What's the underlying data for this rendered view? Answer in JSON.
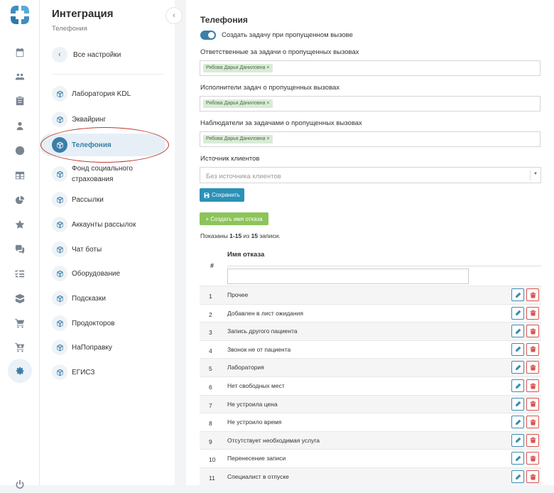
{
  "rail": {
    "icons": [
      "calendar-icon",
      "users-icon",
      "clipboard-icon",
      "user-icon",
      "clock-icon",
      "table-icon",
      "pie-chart-icon",
      "star-icon",
      "chat-icon",
      "list-check-icon",
      "box-icon",
      "cart-icon",
      "cart-plus-icon",
      "gear-icon"
    ],
    "power_icon": "power-icon"
  },
  "panel": {
    "title": "Интеграция",
    "subtitle": "Телефония",
    "collapse": "‹",
    "back": {
      "chevron": "‹",
      "label": "Все настройки"
    },
    "items": [
      {
        "label": "Лаборатория KDL"
      },
      {
        "label": "Эквайринг"
      },
      {
        "label": "Телефония",
        "active": true
      },
      {
        "label": "Фонд социального страхования"
      },
      {
        "label": "Рассылки"
      },
      {
        "label": "Аккаунты рассылок"
      },
      {
        "label": "Чат боты"
      },
      {
        "label": "Оборудование"
      },
      {
        "label": "Подсказки"
      },
      {
        "label": "Продокторов"
      },
      {
        "label": "НаПоправку"
      },
      {
        "label": "ЕГИСЗ"
      }
    ]
  },
  "main": {
    "title": "Телефония",
    "toggle_label": "Создать задачу при пропущенном вызове",
    "toggle_on": true,
    "responsible_label": "Ответственные за задачи о пропущенных вызовах",
    "responsible_tag": "Рябова Дарья Даниловна ×",
    "executors_label": "Исполнители задач о пропущенных вызовах",
    "executors_tag": "Рябова Дарья Даниловна ×",
    "observers_label": "Наблюдатели за задачами о пропущенных вызовах",
    "observers_tag": "Рябова Дарья Даниловна ×",
    "source_label": "Источник клиентов",
    "source_value": "Без источника клиентов",
    "save_button": "Сохранить",
    "add_button": "+ Создать имя отказа",
    "summary": {
      "prefix": "Показаны ",
      "range": "1-15",
      "of": " из ",
      "total": "15",
      "suffix": " записи."
    },
    "table": {
      "col_num": "#",
      "col_name": "Имя отказа",
      "rows": [
        {
          "n": "1",
          "name": "Прочее"
        },
        {
          "n": "2",
          "name": "Добавлен в лист ожидания"
        },
        {
          "n": "3",
          "name": "Запись другого пациента"
        },
        {
          "n": "4",
          "name": "Звонок не от пациента"
        },
        {
          "n": "5",
          "name": "Лаборатория"
        },
        {
          "n": "6",
          "name": "Нет свободных мест"
        },
        {
          "n": "7",
          "name": "Не устроила цена"
        },
        {
          "n": "8",
          "name": "Не устроило время"
        },
        {
          "n": "9",
          "name": "Отсутствует необходимая услуга"
        },
        {
          "n": "10",
          "name": "Перенесение записи"
        },
        {
          "n": "11",
          "name": "Специалист в отпуске"
        }
      ]
    }
  },
  "colors": {
    "accent": "#3b7ea8",
    "save": "#2b91b8",
    "add": "#8cc45a",
    "danger": "#d9534f",
    "highlight": "#c0392b",
    "tag_bg": "#d9ecd6"
  }
}
